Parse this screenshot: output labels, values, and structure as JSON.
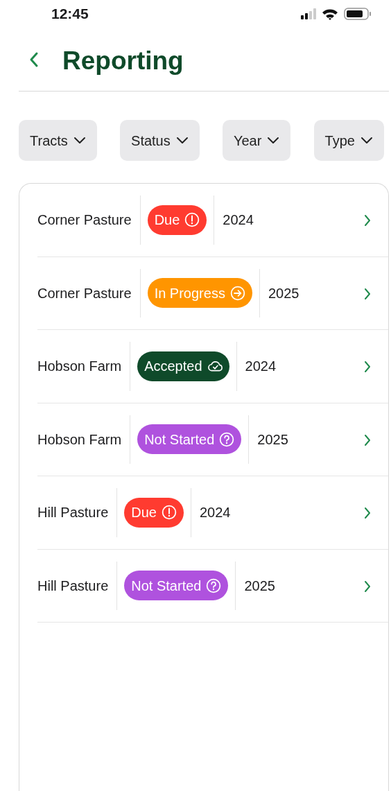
{
  "status_bar": {
    "time": "12:45"
  },
  "header": {
    "title": "Reporting"
  },
  "filters": [
    {
      "label": "Tracts"
    },
    {
      "label": "Status"
    },
    {
      "label": "Year"
    },
    {
      "label": "Type"
    }
  ],
  "reports": [
    {
      "tract": "Corner Pasture",
      "status": {
        "label": "Due",
        "kind": "due",
        "color": "#ff3b30"
      },
      "year": "2024"
    },
    {
      "tract": "Corner Pasture",
      "status": {
        "label": "In Progress",
        "kind": "in_progress",
        "color": "#ff9500"
      },
      "year": "2025"
    },
    {
      "tract": "Hobson Farm",
      "status": {
        "label": "Accepted",
        "kind": "accepted",
        "color": "#0f4a2a"
      },
      "year": "2024"
    },
    {
      "tract": "Hobson Farm",
      "status": {
        "label": "Not Started",
        "kind": "not_started",
        "color": "#af52de"
      },
      "year": "2025"
    },
    {
      "tract": "Hill Pasture",
      "status": {
        "label": "Due",
        "kind": "due",
        "color": "#ff3b30"
      },
      "year": "2024"
    },
    {
      "tract": "Hill Pasture",
      "status": {
        "label": "Not Started",
        "kind": "not_started",
        "color": "#af52de"
      },
      "year": "2025"
    }
  ]
}
